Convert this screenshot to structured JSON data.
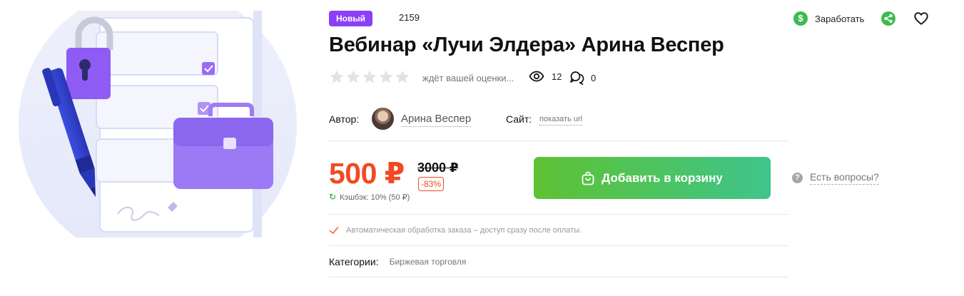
{
  "product": {
    "badge": "Новый",
    "id": "2159",
    "title": "Вебинар «Лучи Элдера» Арина Веспер"
  },
  "actions": {
    "earn_icon_glyph": "$",
    "earn_label": "Заработать",
    "share_icon": "share-icon",
    "favorite_icon": "heart-icon"
  },
  "rating": {
    "stars_filled": 0,
    "stars_total": 5,
    "text": "ждёт вашей оценки...",
    "views": "12",
    "comments": "0"
  },
  "author": {
    "label": "Автор:",
    "name": "Арина Веспер",
    "site_label": "Сайт:",
    "site_link": "показать url"
  },
  "pricing": {
    "price": "500 ₽",
    "old_price": "3000 ₽",
    "discount": "-83%",
    "cashback_icon": "↻",
    "cashback": "Кэшбэк: 10% (50 ₽)"
  },
  "cart": {
    "button_label": "Добавить в корзину"
  },
  "questions": {
    "icon_glyph": "?",
    "label": "Есть вопросы?"
  },
  "notice": {
    "text": "Автоматическая обработка заказа – доступ сразу после оплаты."
  },
  "categories": {
    "label": "Категории:",
    "value": "Биржевая торговля"
  },
  "colors": {
    "accent_purple": "#8b3ff6",
    "price_red": "#f04a24",
    "button_green_start": "#5ec232",
    "button_green_end": "#3ec58c"
  }
}
